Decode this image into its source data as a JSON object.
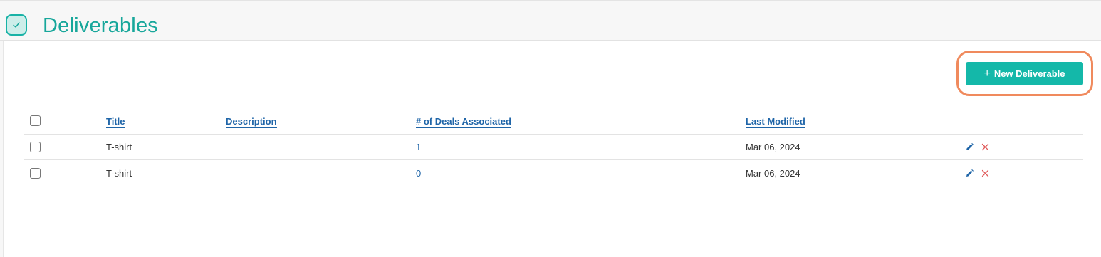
{
  "header": {
    "title": "Deliverables",
    "icon": "check-circle-icon",
    "accent_color": "#18a79b"
  },
  "toolbar": {
    "new_button_label": "New Deliverable",
    "new_button_icon": "plus-icon",
    "button_color": "#14b8a9",
    "highlight_color": "#f08a5d"
  },
  "table": {
    "columns": [
      "Title",
      "Description",
      "# of Deals Associated",
      "Last Modified"
    ],
    "rows": [
      {
        "title": "T-shirt",
        "description": "",
        "deals": "1",
        "modified": "Mar 06, 2024"
      },
      {
        "title": "T-shirt",
        "description": "",
        "deals": "0",
        "modified": "Mar 06, 2024"
      }
    ],
    "link_color": "#1f65a8",
    "delete_color": "#e05a5a"
  }
}
